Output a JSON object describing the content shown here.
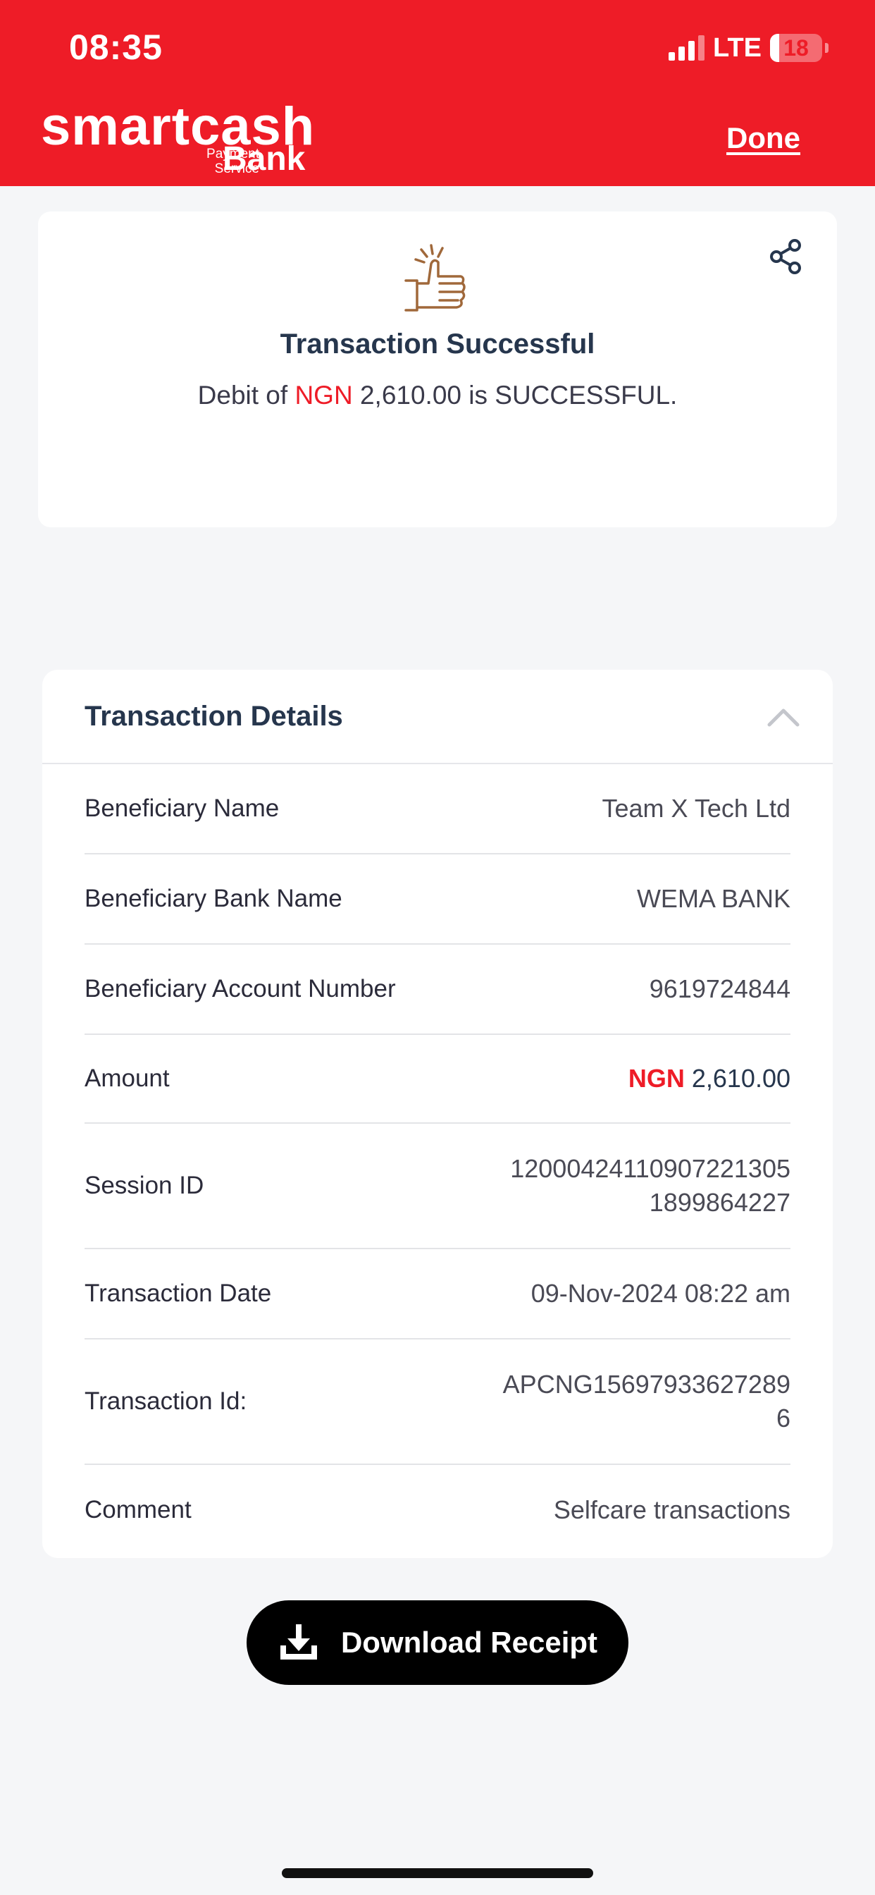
{
  "status_bar": {
    "time": "08:35",
    "network": "LTE",
    "battery": "18",
    "battery_level": 0.18
  },
  "header": {
    "brand": "smartcash",
    "brand_sub": "Payment Service",
    "brand_bank": "Bank",
    "done_label": "Done",
    "bg_color": "#ee1c27"
  },
  "success": {
    "title": "Transaction Successful",
    "msg_prefix": "Debit of ",
    "msg_currency": "NGN",
    "msg_suffix": " 2,610.00 is SUCCESSFUL.",
    "icons": [
      "thumbs-up-icon",
      "share-icon"
    ]
  },
  "details": {
    "title": "Transaction Details",
    "rows": [
      {
        "label": "Beneficiary Name",
        "value": "Team X Tech Ltd"
      },
      {
        "label": "Beneficiary Bank Name",
        "value": "WEMA BANK"
      },
      {
        "label": "Beneficiary Account Number",
        "value": "9619724844"
      },
      {
        "label": "Amount",
        "currency": "NGN",
        "value": "2,610.00"
      },
      {
        "label": "Session ID",
        "value_lines": [
          "12000424110907221305",
          "1899864227"
        ]
      },
      {
        "label": "Transaction Date",
        "value": "09-Nov-2024 08:22 am"
      },
      {
        "label": "Transaction Id:",
        "value_lines": [
          "APCNG15697933627289",
          "6"
        ]
      },
      {
        "label": "Comment",
        "value": "Selfcare transactions"
      }
    ]
  },
  "download": {
    "label": "Download Receipt",
    "icon": "download-icon"
  },
  "accent_color": "#ee1c27"
}
